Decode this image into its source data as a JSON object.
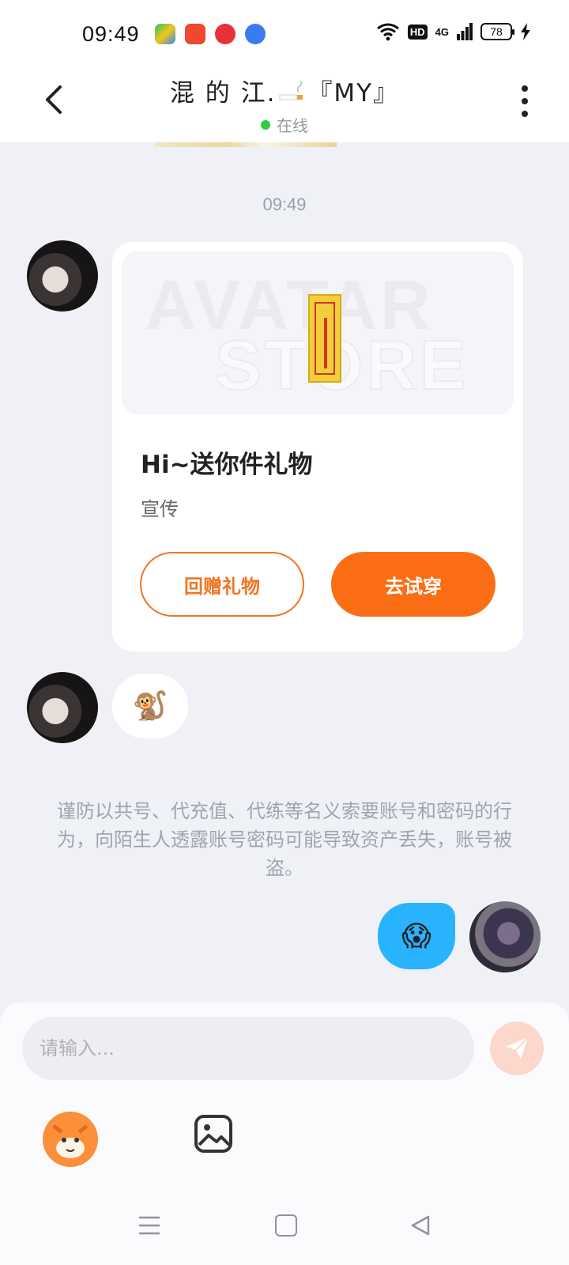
{
  "status_bar": {
    "time": "09:49",
    "network": "4G",
    "hd": "HD",
    "battery": "78"
  },
  "header": {
    "title": "混 的 江.",
    "title_suffix": "『MY』",
    "status": "在线"
  },
  "chat": {
    "timestamp": "09:49",
    "gift_card": {
      "watermark_top": "AVATAR",
      "watermark_bottom": "STORE",
      "title": "Hi~送你件礼物",
      "subtitle": "宣传",
      "return_gift_label": "回赠礼物",
      "try_on_label": "去试穿"
    },
    "received_emoji": "🐒",
    "warning": "谨防以共号、代充值、代练等名义索要账号和密码的行为，向陌生人透露账号密码可能导致资产丢失，账号被盗。",
    "sent_emoji": "😱"
  },
  "composer": {
    "placeholder": "请输入..."
  },
  "colors": {
    "accent": "#fb6e15",
    "sent_bubble": "#29b3ff",
    "online": "#2ecc40",
    "background": "#eff1f6"
  }
}
